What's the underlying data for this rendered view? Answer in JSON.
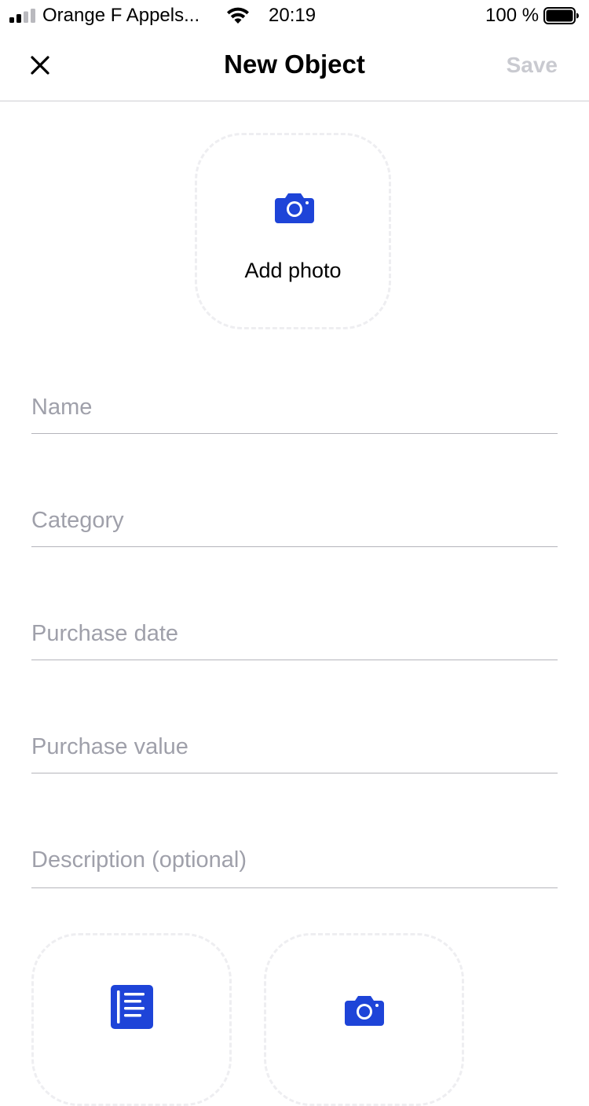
{
  "status_bar": {
    "carrier": "Orange F Appels...",
    "time": "20:19",
    "battery_percent": "100 %",
    "signal_bars_active": 2,
    "signal_bars_total": 4,
    "battery_level": 1.0
  },
  "nav": {
    "title": "New Object",
    "save_label": "Save",
    "close_icon": "close-icon"
  },
  "photo": {
    "label": "Add photo",
    "icon": "camera-icon"
  },
  "form": {
    "name": {
      "value": "",
      "placeholder": "Name"
    },
    "category": {
      "value": "",
      "placeholder": "Category"
    },
    "purchase_date": {
      "value": "",
      "placeholder": "Purchase date"
    },
    "purchase_value": {
      "value": "",
      "placeholder": "Purchase value"
    },
    "description": {
      "value": "",
      "placeholder": "Description (optional)"
    }
  },
  "attachments": {
    "document_icon": "document-icon",
    "photo_icon": "camera-icon"
  },
  "colors": {
    "accent": "#1e44d8",
    "save_disabled": "#c9cad0",
    "placeholder": "#9fa0aa",
    "divider": "#b5b5bb",
    "dashed_border": "#eeeef1"
  }
}
